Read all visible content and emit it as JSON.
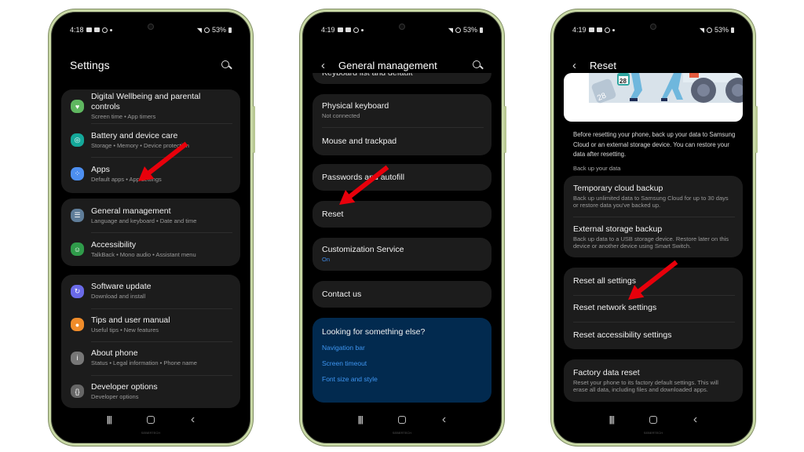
{
  "phones": [
    {
      "status": {
        "time": "4:18",
        "battery": "53%"
      },
      "header": {
        "title": "Settings",
        "search_icon": "search-icon"
      },
      "groups": [
        [
          {
            "title": "Digital Wellbeing and parental controls",
            "subtitle": "Screen time  •  App timers",
            "icon": "digital-wellbeing-icon",
            "color": "#5fb760"
          },
          {
            "title": "Battery and device care",
            "subtitle": "Storage  •  Memory  •  Device protection",
            "icon": "device-care-icon",
            "color": "#14a89a"
          },
          {
            "title": "Apps",
            "subtitle": "Default apps  •  App settings",
            "icon": "apps-icon",
            "color": "#4d8ff0"
          }
        ],
        [
          {
            "title": "General management",
            "subtitle": "Language and keyboard  •  Date and time",
            "icon": "general-management-icon",
            "color": "#5f7d99"
          },
          {
            "title": "Accessibility",
            "subtitle": "TalkBack  •  Mono audio  •  Assistant menu",
            "icon": "accessibility-icon",
            "color": "#2f9b4a"
          }
        ],
        [
          {
            "title": "Software update",
            "subtitle": "Download and install",
            "icon": "software-update-icon",
            "color": "#6a6ae8"
          },
          {
            "title": "Tips and user manual",
            "subtitle": "Useful tips  •  New features",
            "icon": "tips-icon",
            "color": "#f08c2a"
          },
          {
            "title": "About phone",
            "subtitle": "Status  •  Legal information  •  Phone name",
            "icon": "about-phone-icon",
            "color": "#777777"
          },
          {
            "title": "Developer options",
            "subtitle": "Developer options",
            "icon": "developer-options-icon",
            "color": "#666666"
          }
        ]
      ]
    },
    {
      "status": {
        "time": "4:19",
        "battery": "53%"
      },
      "header": {
        "title": "General management",
        "back_icon": "back-icon",
        "search_icon": "search-icon"
      },
      "partial_item": "Keyboard list and default",
      "groups": [
        [
          {
            "title": "Physical keyboard",
            "subtitle": "Not connected"
          },
          {
            "title": "Mouse and trackpad"
          }
        ],
        [
          {
            "title": "Passwords and autofill"
          }
        ],
        [
          {
            "title": "Reset"
          }
        ],
        [
          {
            "title": "Customization Service",
            "subtitle": "On",
            "subtitle_color": "#3e8ae8"
          }
        ],
        [
          {
            "title": "Contact us"
          }
        ]
      ],
      "help": {
        "heading": "Looking for something else?",
        "links": [
          "Navigation bar",
          "Screen timeout",
          "Font size and style"
        ]
      }
    },
    {
      "status": {
        "time": "4:19",
        "battery": "53%"
      },
      "header": {
        "title": "Reset",
        "back_icon": "back-icon"
      },
      "banner": {
        "calendar_day": "28"
      },
      "intro": "Before resetting your phone, back up your data to Samsung Cloud or an external storage device. You can restore your data after resetting.",
      "section_label": "Back up your data",
      "groups": [
        [
          {
            "title": "Temporary cloud backup",
            "subtitle": "Back up unlimited data to Samsung Cloud for up to 30 days or restore data you've backed up."
          },
          {
            "title": "External storage backup",
            "subtitle": "Back up data to a USB storage device. Restore later on this device or another device using Smart Switch."
          }
        ],
        [
          {
            "title": "Reset all settings"
          },
          {
            "title": "Reset network settings"
          },
          {
            "title": "Reset accessibility settings"
          }
        ],
        [
          {
            "title": "Factory data reset",
            "subtitle": "Reset your phone to its factory default settings. This will erase all data, including files and downloaded apps."
          }
        ]
      ]
    }
  ],
  "nav": {
    "recent": "|||",
    "back": "‹"
  },
  "watermark": "SEBERTECH",
  "annotation_color": "#e8000b"
}
